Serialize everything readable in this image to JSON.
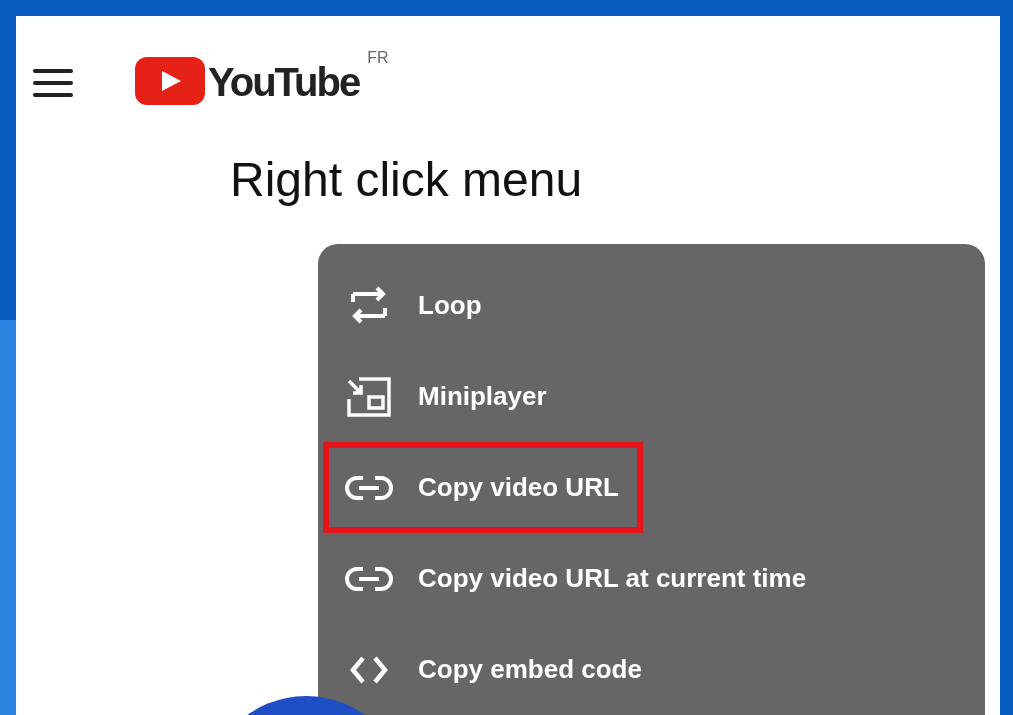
{
  "header": {
    "logo_text": "YouTube",
    "region": "FR"
  },
  "title": "Right click menu",
  "context_menu": {
    "items": [
      {
        "kind": "loop",
        "label": "Loop",
        "highlighted": false
      },
      {
        "kind": "miniplayer",
        "label": "Miniplayer",
        "highlighted": false
      },
      {
        "kind": "link",
        "label": "Copy video URL",
        "highlighted": true
      },
      {
        "kind": "link",
        "label": "Copy video URL at current time",
        "highlighted": false
      },
      {
        "kind": "code",
        "label": "Copy embed code",
        "highlighted": false
      }
    ]
  }
}
